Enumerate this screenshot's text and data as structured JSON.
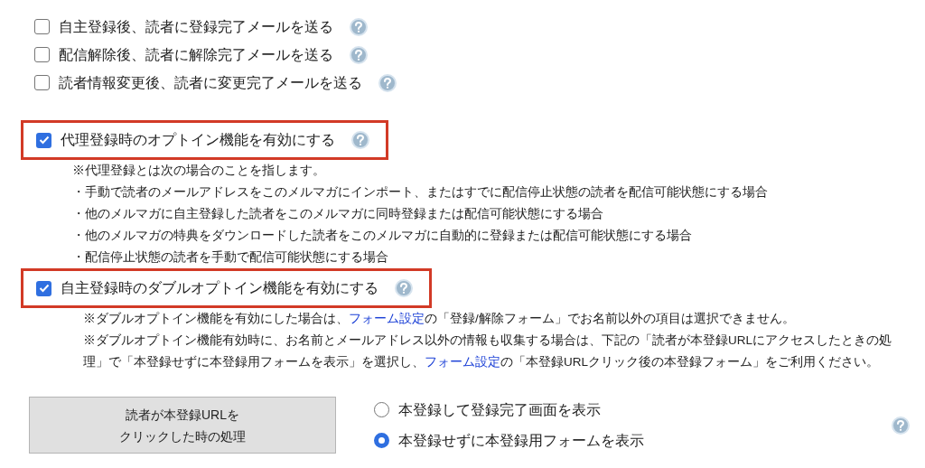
{
  "options": [
    {
      "label": "自主登録後、読者に登録完了メールを送る",
      "checked": false,
      "highlighted": false
    },
    {
      "label": "配信解除後、読者に解除完了メールを送る",
      "checked": false,
      "highlighted": false
    },
    {
      "label": "読者情報変更後、読者に変更完了メールを送る",
      "checked": false,
      "highlighted": false
    },
    {
      "label": "代理登録時のオプトイン機能を有効にする",
      "checked": true,
      "highlighted": true,
      "notes": [
        [
          {
            "kind": "text",
            "text": "※代理登録とは次の場合のことを指します。"
          }
        ],
        [
          {
            "kind": "text",
            "text": "・手動で読者のメールアドレスをこのメルマガにインポート、またはすでに配信停止状態の読者を配信可能状態にする場合"
          }
        ],
        [
          {
            "kind": "text",
            "text": "・他のメルマガに自主登録した読者をこのメルマガに同時登録または配信可能状態にする場合"
          }
        ],
        [
          {
            "kind": "text",
            "text": "・他のメルマガの特典をダウンロードした読者をこのメルマガに自動的に登録または配信可能状態にする場合"
          }
        ],
        [
          {
            "kind": "text",
            "text": "・配信停止状態の読者を手動で配信可能状態にする場合"
          }
        ]
      ]
    },
    {
      "label": "自主登録時のダブルオプトイン機能を有効にする",
      "checked": true,
      "highlighted": true,
      "notes": [
        [
          {
            "kind": "text",
            "text": "※ダブルオプトイン機能を有効にした場合は、"
          },
          {
            "kind": "link",
            "text": "フォーム設定"
          },
          {
            "kind": "text",
            "text": "の「登録/解除フォーム」でお名前以外の項目は選択できません。"
          }
        ],
        [
          {
            "kind": "text",
            "text": "※ダブルオプトイン機能有効時に、お名前とメールアドレス以外の情報も収集する場合は、下記の「読者が本登録URLにアクセスしたときの処理」で「本登録せずに本登録用フォームを表示」を選択し、"
          },
          {
            "kind": "link",
            "text": "フォーム設定"
          },
          {
            "kind": "text",
            "text": "の「本登録URLクリック後の本登録フォーム」をご利用ください。"
          }
        ]
      ]
    }
  ],
  "setting": {
    "label_lines": [
      "読者が本登録URLを",
      "クリックした時の処理"
    ],
    "choices": [
      {
        "label": "本登録して登録完了画面を表示",
        "selected": false
      },
      {
        "label": "本登録せずに本登録用フォームを表示",
        "selected": true
      }
    ]
  }
}
